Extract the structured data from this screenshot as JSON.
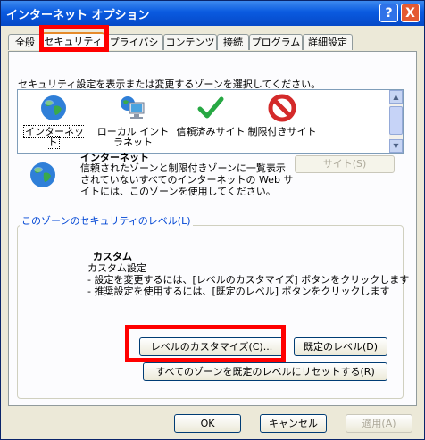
{
  "window": {
    "title": "インターネット オプション",
    "help_label": "?",
    "close_label": "X"
  },
  "tabs": [
    {
      "label": "全般"
    },
    {
      "label": "セキュリティ"
    },
    {
      "label": "プライバシー"
    },
    {
      "label": "コンテンツ"
    },
    {
      "label": "接続"
    },
    {
      "label": "プログラム"
    },
    {
      "label": "詳細設定"
    }
  ],
  "security": {
    "select_text": "セキュリティ設定を表示または変更するゾーンを選択してください。",
    "zones": [
      {
        "label": "インターネット",
        "icon": "globe-icon"
      },
      {
        "label": "ローカル イントラネット",
        "icon": "computer-globe-icon"
      },
      {
        "label": "信頼済みサイト",
        "icon": "checkmark-icon"
      },
      {
        "label": "制限付きサイト",
        "icon": "no-entry-icon"
      }
    ],
    "selected_zone_name": "インターネット",
    "selected_zone_desc": "信頼されたゾーンと制限付きゾーンに一覧表示されていないすべてのインターネットの Web サイトには、このゾーンを使用してください。",
    "site_button": "サイト(S)",
    "level_group_title": "このゾーンのセキュリティのレベル(L)",
    "custom_title": "カスタム",
    "custom_line1": "カスタム設定",
    "custom_line2": "- 設定を変更するには、[レベルのカスタマイズ] ボタンをクリックします",
    "custom_line3": "- 推奨設定を使用するには、[既定のレベル] ボタンをクリックします",
    "customize_button": "レベルのカスタマイズ(C)...",
    "default_button": "既定のレベル(D)",
    "reset_button": "すべてのゾーンを既定のレベルにリセットする(R)"
  },
  "footer": {
    "ok": "OK",
    "cancel": "キャンセル",
    "apply": "適用(A)"
  }
}
